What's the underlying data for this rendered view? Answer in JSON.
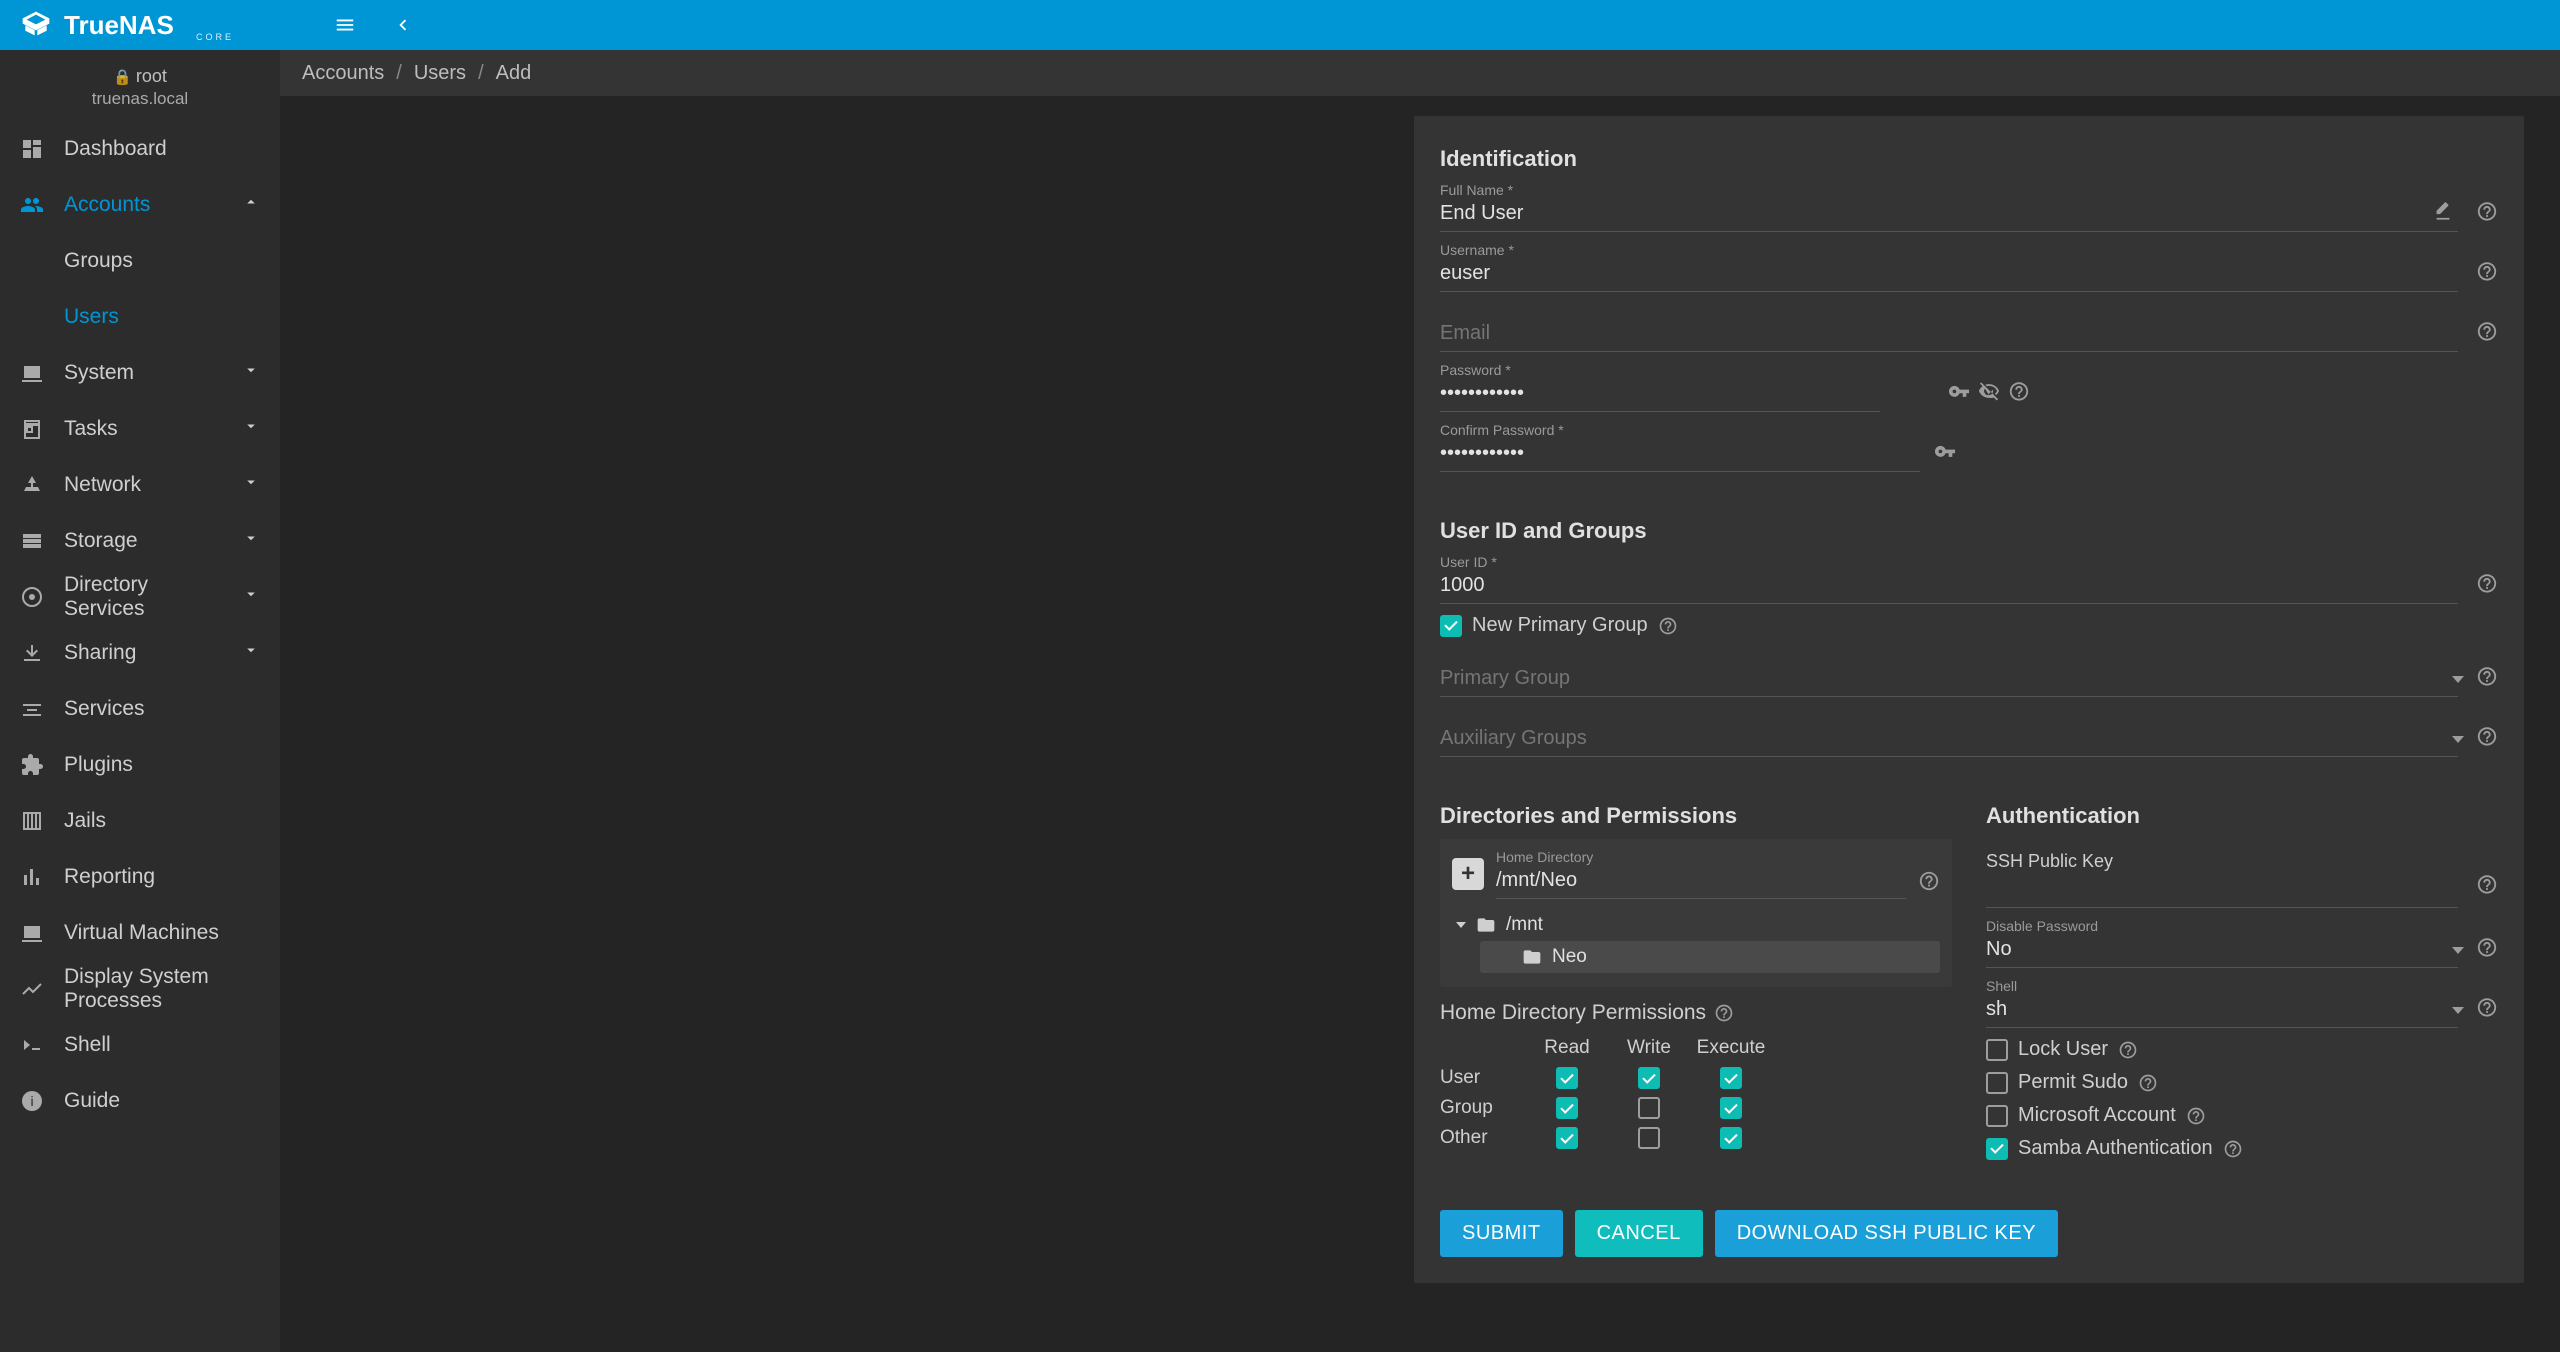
{
  "logo": {
    "brand": "TrueNAS",
    "edition": "CORE"
  },
  "host": {
    "user": "root",
    "name": "truenas.local"
  },
  "nav": {
    "dashboard": "Dashboard",
    "accounts": "Accounts",
    "accounts_groups": "Groups",
    "accounts_users": "Users",
    "system": "System",
    "tasks": "Tasks",
    "network": "Network",
    "storage": "Storage",
    "directory_services": "Directory Services",
    "sharing": "Sharing",
    "services": "Services",
    "plugins": "Plugins",
    "jails": "Jails",
    "reporting": "Reporting",
    "vms": "Virtual Machines",
    "sysproc": "Display System Processes",
    "shell": "Shell",
    "guide": "Guide"
  },
  "breadcrumb": [
    "Accounts",
    "Users",
    "Add"
  ],
  "form": {
    "identification": {
      "title": "Identification",
      "full_name_label": "Full Name *",
      "full_name": "End User",
      "username_label": "Username *",
      "username": "euser",
      "email_label": "Email",
      "email": "",
      "password_label": "Password *",
      "password": "••••••••••••",
      "confirm_password_label": "Confirm Password *",
      "confirm_password": "••••••••••••"
    },
    "uidgrp": {
      "title": "User ID and Groups",
      "uid_label": "User ID *",
      "uid": "1000",
      "new_primary_group": {
        "label": "New Primary Group",
        "checked": true
      },
      "primary_group_label": "Primary Group",
      "primary_group": "",
      "aux_groups_label": "Auxiliary Groups",
      "aux_groups": ""
    },
    "dirperm": {
      "title": "Directories and Permissions",
      "home_dir_label": "Home Directory",
      "home_dir": "/mnt/Neo",
      "tree": {
        "root": "/mnt",
        "child": "Neo"
      },
      "perm_title": "Home Directory Permissions",
      "headers": [
        "Read",
        "Write",
        "Execute"
      ],
      "rows": [
        "User",
        "Group",
        "Other"
      ],
      "matrix": [
        [
          true,
          true,
          true
        ],
        [
          true,
          false,
          true
        ],
        [
          true,
          false,
          true
        ]
      ]
    },
    "auth": {
      "title": "Authentication",
      "ssh_label": "SSH Public Key",
      "ssh": "",
      "disable_pw_label": "Disable Password",
      "disable_pw": "No",
      "shell_label": "Shell",
      "shell": "sh",
      "lock_user": {
        "label": "Lock User",
        "checked": false
      },
      "permit_sudo": {
        "label": "Permit Sudo",
        "checked": false
      },
      "ms_account": {
        "label": "Microsoft Account",
        "checked": false
      },
      "samba_auth": {
        "label": "Samba Authentication",
        "checked": true
      }
    },
    "buttons": {
      "submit": "SUBMIT",
      "cancel": "CANCEL",
      "download_ssh": "DOWNLOAD SSH PUBLIC KEY"
    }
  }
}
